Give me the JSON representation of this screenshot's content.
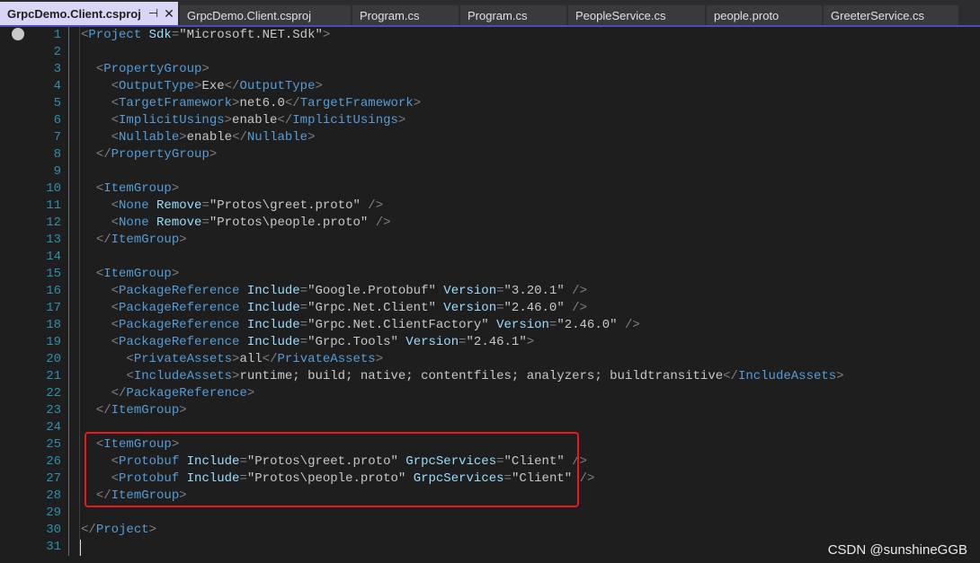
{
  "tabs": [
    {
      "label": "GrpcDemo.Client.csproj",
      "active": true,
      "pin": "⊣",
      "close": "✕"
    },
    {
      "label": "GrpcDemo.Client.csproj",
      "active": false
    },
    {
      "label": "Program.cs",
      "active": false
    },
    {
      "label": "Program.cs",
      "active": false
    },
    {
      "label": "PeopleService.cs",
      "active": false
    },
    {
      "label": "people.proto",
      "active": false
    },
    {
      "label": "GreeterService.cs",
      "active": false
    }
  ],
  "editor": {
    "lines": [
      {
        "n": "1",
        "fold": true,
        "indent": "",
        "tokens": [
          [
            "brk",
            "<"
          ],
          [
            "tag",
            "Project"
          ],
          [
            "txt",
            " "
          ],
          [
            "attr",
            "Sdk"
          ],
          [
            "brk",
            "="
          ],
          [
            "val",
            "\"Microsoft.NET.Sdk\""
          ],
          [
            "brk",
            ">"
          ]
        ]
      },
      {
        "n": "2",
        "indent": "",
        "tokens": []
      },
      {
        "n": "3",
        "fold": true,
        "indent": "  ",
        "tokens": [
          [
            "brk",
            "<"
          ],
          [
            "tag",
            "PropertyGroup"
          ],
          [
            "brk",
            ">"
          ]
        ]
      },
      {
        "n": "4",
        "indent": "    ",
        "tokens": [
          [
            "brk",
            "<"
          ],
          [
            "tag",
            "OutputType"
          ],
          [
            "brk",
            ">"
          ],
          [
            "txt",
            "Exe"
          ],
          [
            "brk",
            "</"
          ],
          [
            "tag",
            "OutputType"
          ],
          [
            "brk",
            ">"
          ]
        ]
      },
      {
        "n": "5",
        "indent": "    ",
        "tokens": [
          [
            "brk",
            "<"
          ],
          [
            "tag",
            "TargetFramework"
          ],
          [
            "brk",
            ">"
          ],
          [
            "txt",
            "net6.0"
          ],
          [
            "brk",
            "</"
          ],
          [
            "tag",
            "TargetFramework"
          ],
          [
            "brk",
            ">"
          ]
        ]
      },
      {
        "n": "6",
        "indent": "    ",
        "tokens": [
          [
            "brk",
            "<"
          ],
          [
            "tag",
            "ImplicitUsings"
          ],
          [
            "brk",
            ">"
          ],
          [
            "txt",
            "enable"
          ],
          [
            "brk",
            "</"
          ],
          [
            "tag",
            "ImplicitUsings"
          ],
          [
            "brk",
            ">"
          ]
        ]
      },
      {
        "n": "7",
        "indent": "    ",
        "tokens": [
          [
            "brk",
            "<"
          ],
          [
            "tag",
            "Nullable"
          ],
          [
            "brk",
            ">"
          ],
          [
            "txt",
            "enable"
          ],
          [
            "brk",
            "</"
          ],
          [
            "tag",
            "Nullable"
          ],
          [
            "brk",
            ">"
          ]
        ]
      },
      {
        "n": "8",
        "indent": "  ",
        "tokens": [
          [
            "brk",
            "</"
          ],
          [
            "tag",
            "PropertyGroup"
          ],
          [
            "brk",
            ">"
          ]
        ]
      },
      {
        "n": "9",
        "indent": "",
        "tokens": []
      },
      {
        "n": "10",
        "fold": true,
        "indent": "  ",
        "tokens": [
          [
            "brk",
            "<"
          ],
          [
            "tag",
            "ItemGroup"
          ],
          [
            "brk",
            ">"
          ]
        ]
      },
      {
        "n": "11",
        "indent": "    ",
        "tokens": [
          [
            "brk",
            "<"
          ],
          [
            "tag",
            "None"
          ],
          [
            "txt",
            " "
          ],
          [
            "attr",
            "Remove"
          ],
          [
            "brk",
            "="
          ],
          [
            "val",
            "\"Protos\\greet.proto\""
          ],
          [
            "txt",
            " "
          ],
          [
            "brk",
            "/>"
          ]
        ]
      },
      {
        "n": "12",
        "indent": "    ",
        "tokens": [
          [
            "brk",
            "<"
          ],
          [
            "tag",
            "None"
          ],
          [
            "txt",
            " "
          ],
          [
            "attr",
            "Remove"
          ],
          [
            "brk",
            "="
          ],
          [
            "val",
            "\"Protos\\people.proto\""
          ],
          [
            "txt",
            " "
          ],
          [
            "brk",
            "/>"
          ]
        ]
      },
      {
        "n": "13",
        "indent": "  ",
        "tokens": [
          [
            "brk",
            "</"
          ],
          [
            "tag",
            "ItemGroup"
          ],
          [
            "brk",
            ">"
          ]
        ]
      },
      {
        "n": "14",
        "indent": "",
        "tokens": []
      },
      {
        "n": "15",
        "fold": true,
        "indent": "  ",
        "tokens": [
          [
            "brk",
            "<"
          ],
          [
            "tag",
            "ItemGroup"
          ],
          [
            "brk",
            ">"
          ]
        ]
      },
      {
        "n": "16",
        "indent": "    ",
        "tokens": [
          [
            "brk",
            "<"
          ],
          [
            "tag",
            "PackageReference"
          ],
          [
            "txt",
            " "
          ],
          [
            "attr",
            "Include"
          ],
          [
            "brk",
            "="
          ],
          [
            "val",
            "\"Google.Protobuf\""
          ],
          [
            "txt",
            " "
          ],
          [
            "attr",
            "Version"
          ],
          [
            "brk",
            "="
          ],
          [
            "val",
            "\"3.20.1\""
          ],
          [
            "txt",
            " "
          ],
          [
            "brk",
            "/>"
          ]
        ]
      },
      {
        "n": "17",
        "indent": "    ",
        "tokens": [
          [
            "brk",
            "<"
          ],
          [
            "tag",
            "PackageReference"
          ],
          [
            "txt",
            " "
          ],
          [
            "attr",
            "Include"
          ],
          [
            "brk",
            "="
          ],
          [
            "val",
            "\"Grpc.Net.Client\""
          ],
          [
            "txt",
            " "
          ],
          [
            "attr",
            "Version"
          ],
          [
            "brk",
            "="
          ],
          [
            "val",
            "\"2.46.0\""
          ],
          [
            "txt",
            " "
          ],
          [
            "brk",
            "/>"
          ]
        ]
      },
      {
        "n": "18",
        "indent": "    ",
        "tokens": [
          [
            "brk",
            "<"
          ],
          [
            "tag",
            "PackageReference"
          ],
          [
            "txt",
            " "
          ],
          [
            "attr",
            "Include"
          ],
          [
            "brk",
            "="
          ],
          [
            "val",
            "\"Grpc.Net.ClientFactory\""
          ],
          [
            "txt",
            " "
          ],
          [
            "attr",
            "Version"
          ],
          [
            "brk",
            "="
          ],
          [
            "val",
            "\"2.46.0\""
          ],
          [
            "txt",
            " "
          ],
          [
            "brk",
            "/>"
          ]
        ]
      },
      {
        "n": "19",
        "fold": true,
        "indent": "    ",
        "tokens": [
          [
            "brk",
            "<"
          ],
          [
            "tag",
            "PackageReference"
          ],
          [
            "txt",
            " "
          ],
          [
            "attr",
            "Include"
          ],
          [
            "brk",
            "="
          ],
          [
            "val",
            "\"Grpc.Tools\""
          ],
          [
            "txt",
            " "
          ],
          [
            "attr",
            "Version"
          ],
          [
            "brk",
            "="
          ],
          [
            "val",
            "\"2.46.1\""
          ],
          [
            "brk",
            ">"
          ]
        ]
      },
      {
        "n": "20",
        "indent": "      ",
        "tokens": [
          [
            "brk",
            "<"
          ],
          [
            "tag",
            "PrivateAssets"
          ],
          [
            "brk",
            ">"
          ],
          [
            "txt",
            "all"
          ],
          [
            "brk",
            "</"
          ],
          [
            "tag",
            "PrivateAssets"
          ],
          [
            "brk",
            ">"
          ]
        ]
      },
      {
        "n": "21",
        "indent": "      ",
        "tokens": [
          [
            "brk",
            "<"
          ],
          [
            "tag",
            "IncludeAssets"
          ],
          [
            "brk",
            ">"
          ],
          [
            "txt",
            "runtime; build; native; contentfiles; analyzers; buildtransitive"
          ],
          [
            "brk",
            "</"
          ],
          [
            "tag",
            "IncludeAssets"
          ],
          [
            "brk",
            ">"
          ]
        ]
      },
      {
        "n": "22",
        "indent": "    ",
        "tokens": [
          [
            "brk",
            "</"
          ],
          [
            "tag",
            "PackageReference"
          ],
          [
            "brk",
            ">"
          ]
        ]
      },
      {
        "n": "23",
        "indent": "  ",
        "tokens": [
          [
            "brk",
            "</"
          ],
          [
            "tag",
            "ItemGroup"
          ],
          [
            "brk",
            ">"
          ]
        ]
      },
      {
        "n": "24",
        "indent": "",
        "tokens": []
      },
      {
        "n": "25",
        "fold": true,
        "indent": "  ",
        "tokens": [
          [
            "brk",
            "<"
          ],
          [
            "tag",
            "ItemGroup"
          ],
          [
            "brk",
            ">"
          ]
        ]
      },
      {
        "n": "26",
        "indent": "    ",
        "tokens": [
          [
            "brk",
            "<"
          ],
          [
            "tag",
            "Protobuf"
          ],
          [
            "txt",
            " "
          ],
          [
            "attr",
            "Include"
          ],
          [
            "brk",
            "="
          ],
          [
            "val",
            "\"Protos\\greet.proto\""
          ],
          [
            "txt",
            " "
          ],
          [
            "attr",
            "GrpcServices"
          ],
          [
            "brk",
            "="
          ],
          [
            "val",
            "\"Client\""
          ],
          [
            "txt",
            " "
          ],
          [
            "brk",
            "/>"
          ]
        ]
      },
      {
        "n": "27",
        "indent": "    ",
        "tokens": [
          [
            "brk",
            "<"
          ],
          [
            "tag",
            "Protobuf"
          ],
          [
            "txt",
            " "
          ],
          [
            "attr",
            "Include"
          ],
          [
            "brk",
            "="
          ],
          [
            "val",
            "\"Protos\\people.proto\""
          ],
          [
            "txt",
            " "
          ],
          [
            "attr",
            "GrpcServices"
          ],
          [
            "brk",
            "="
          ],
          [
            "val",
            "\"Client\""
          ],
          [
            "txt",
            " "
          ],
          [
            "brk",
            "/>"
          ]
        ]
      },
      {
        "n": "28",
        "indent": "  ",
        "tokens": [
          [
            "brk",
            "</"
          ],
          [
            "tag",
            "ItemGroup"
          ],
          [
            "brk",
            ">"
          ]
        ]
      },
      {
        "n": "29",
        "indent": "",
        "tokens": []
      },
      {
        "n": "30",
        "indent": "",
        "tokens": [
          [
            "brk",
            "</"
          ],
          [
            "tag",
            "Project"
          ],
          [
            "brk",
            ">"
          ]
        ]
      },
      {
        "n": "31",
        "indent": "",
        "tokens": []
      }
    ]
  },
  "watermark": "CSDN @sunshineGGB",
  "colors": {
    "accent": "#4e4cb2",
    "line_number": "#2b91af",
    "tag": "#569cd6",
    "attr": "#9cdcfe",
    "bracket": "#808080",
    "highlight_box": "#e8191c"
  }
}
